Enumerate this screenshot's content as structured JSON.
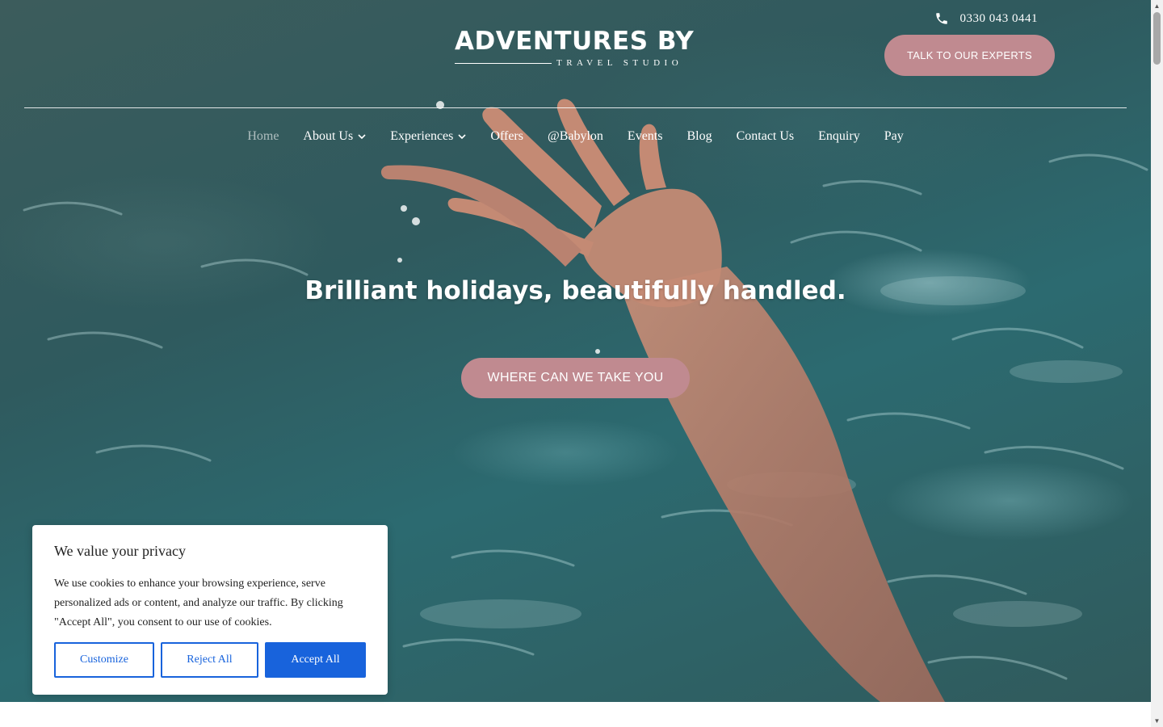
{
  "header": {
    "phone": {
      "icon": "phone-icon",
      "number": "0330 043 0441"
    },
    "cta_label": "TALK TO OUR EXPERTS",
    "logo": {
      "main": "ADVENTURES BY",
      "sub": "TRAVEL STUDIO"
    }
  },
  "nav": {
    "items": [
      {
        "label": "Home",
        "active": true
      },
      {
        "label": "About Us",
        "dropdown": true,
        "icon": "chevron-down-icon"
      },
      {
        "label": "Experiences",
        "dropdown": true,
        "icon": "chevron-down-icon"
      },
      {
        "label": "Offers"
      },
      {
        "label": "@Babylon"
      },
      {
        "label": "Events"
      },
      {
        "label": "Blog"
      },
      {
        "label": "Contact Us"
      },
      {
        "label": "Enquiry"
      },
      {
        "label": "Pay"
      }
    ]
  },
  "hero": {
    "headline": "Brilliant holidays, beautifully handled.",
    "cta_label": "WHERE CAN WE TAKE YOU"
  },
  "cookie": {
    "title": "We value your privacy",
    "text": "We use cookies to enhance your browsing experience, serve personalized ads or content, and analyze our traffic. By clicking \"Accept All\", you consent to our use of cookies.",
    "buttons": {
      "customize": "Customize",
      "reject": "Reject All",
      "accept": "Accept All"
    }
  },
  "colors": {
    "accent_pink": "#c08a90",
    "cookie_blue": "#1863dc",
    "text_white": "#ffffff"
  }
}
